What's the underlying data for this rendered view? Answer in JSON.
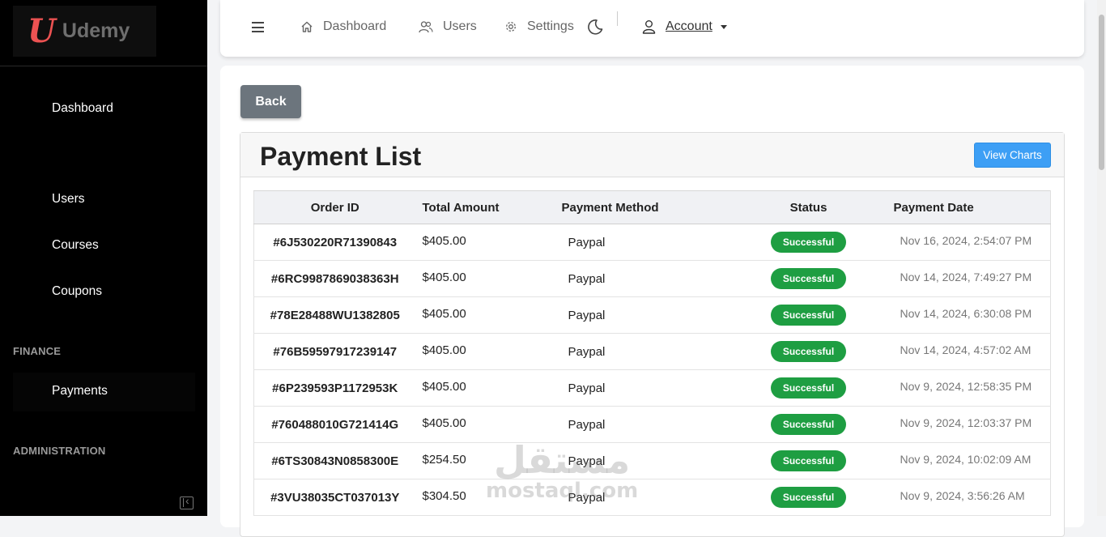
{
  "brand": {
    "logo_letter": "U",
    "name": "Udemy",
    "accent": "#ec5252"
  },
  "sidebar": {
    "items": [
      {
        "label": "Dashboard"
      },
      {
        "label": "Users"
      },
      {
        "label": "Courses"
      },
      {
        "label": "Coupons"
      }
    ],
    "finance_title": "FINANCE",
    "finance_items": [
      {
        "label": "Payments",
        "active": true
      }
    ],
    "admin_title": "ADMINISTRATION"
  },
  "topbar": {
    "dashboard": "Dashboard",
    "users": "Users",
    "settings": "Settings",
    "account": "Account",
    "icons": [
      "menu-icon",
      "home-icon",
      "users-icon",
      "gear-icon",
      "moon-icon",
      "user-icon"
    ]
  },
  "main": {
    "back_label": "Back",
    "title": "Payment List",
    "view_charts_label": "View Charts",
    "columns": [
      "Order ID",
      "Total Amount",
      "Payment Method",
      "Status",
      "Payment Date"
    ],
    "rows": [
      {
        "id": "#6J530220R71390843",
        "amount": "$405.00",
        "method": "Paypal",
        "status": "Successful",
        "date": "Nov 16, 2024, 2:54:07 PM"
      },
      {
        "id": "#6RC9987869038363H",
        "amount": "$405.00",
        "method": "Paypal",
        "status": "Successful",
        "date": "Nov 14, 2024, 7:49:27 PM"
      },
      {
        "id": "#78E28488WU1382805",
        "amount": "$405.00",
        "method": "Paypal",
        "status": "Successful",
        "date": "Nov 14, 2024, 6:30:08 PM"
      },
      {
        "id": "#76B59597917239147",
        "amount": "$405.00",
        "method": "Paypal",
        "status": "Successful",
        "date": "Nov 14, 2024, 4:57:02 AM"
      },
      {
        "id": "#6P239593P1172953K",
        "amount": "$405.00",
        "method": "Paypal",
        "status": "Successful",
        "date": "Nov 9, 2024, 12:58:35 PM"
      },
      {
        "id": "#760488010G721414G",
        "amount": "$405.00",
        "method": "Paypal",
        "status": "Successful",
        "date": "Nov 9, 2024, 12:03:37 PM"
      },
      {
        "id": "#6TS30843N0858300E",
        "amount": "$254.50",
        "method": "Paypal",
        "status": "Successful",
        "date": "Nov 9, 2024, 10:02:09 AM"
      },
      {
        "id": "#3VU38035CT037013Y",
        "amount": "$304.50",
        "method": "Paypal",
        "status": "Successful",
        "date": "Nov 9, 2024, 3:56:26 AM"
      }
    ],
    "status_color": "#1e9e42",
    "primary_color": "#3d9ff5"
  },
  "watermark": {
    "arabic": "مستقل",
    "latin": "mostaql.com"
  }
}
